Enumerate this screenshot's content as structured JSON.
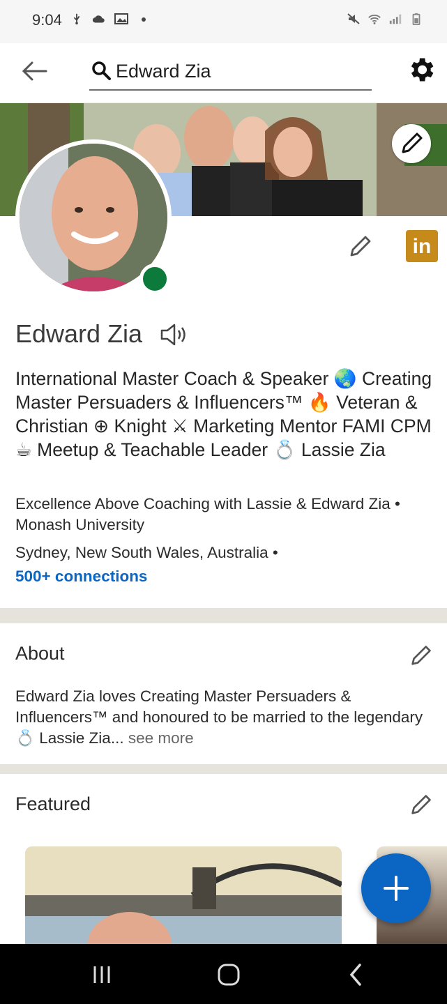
{
  "status_bar": {
    "time": "9:04",
    "left_icons": [
      "usb-icon",
      "cloud-icon",
      "image-icon",
      "dot-icon"
    ],
    "right_icons": [
      "mute-icon",
      "wifi-icon",
      "signal-icon",
      "battery-icon"
    ]
  },
  "search": {
    "value": "Edward Zia"
  },
  "profile": {
    "name": "Edward Zia",
    "headline": "International Master Coach & Speaker 🌏 Creating Master Persuaders & Influencers™ 🔥 Veteran & Christian ⊕ Knight ⚔ Marketing Mentor FAMI CPM ☕ Meetup & Teachable Leader 💍 Lassie Zia",
    "company": "Excellence Above Coaching with Lassie & Edward Zia • Monash University",
    "location": "Sydney, New South Wales, Australia •",
    "connections": "500+ connections",
    "badge_letters": "in"
  },
  "about": {
    "title": "About",
    "text": "Edward Zia loves Creating Master Persuaders & Influencers™ and honoured to be married to the legendary 💍 Lassie Zia...",
    "see_more": " see more"
  },
  "featured": {
    "title": "Featured"
  },
  "colors": {
    "accent": "#0a66c2",
    "online": "#0b7a3a",
    "badge": "#c58a1a"
  }
}
